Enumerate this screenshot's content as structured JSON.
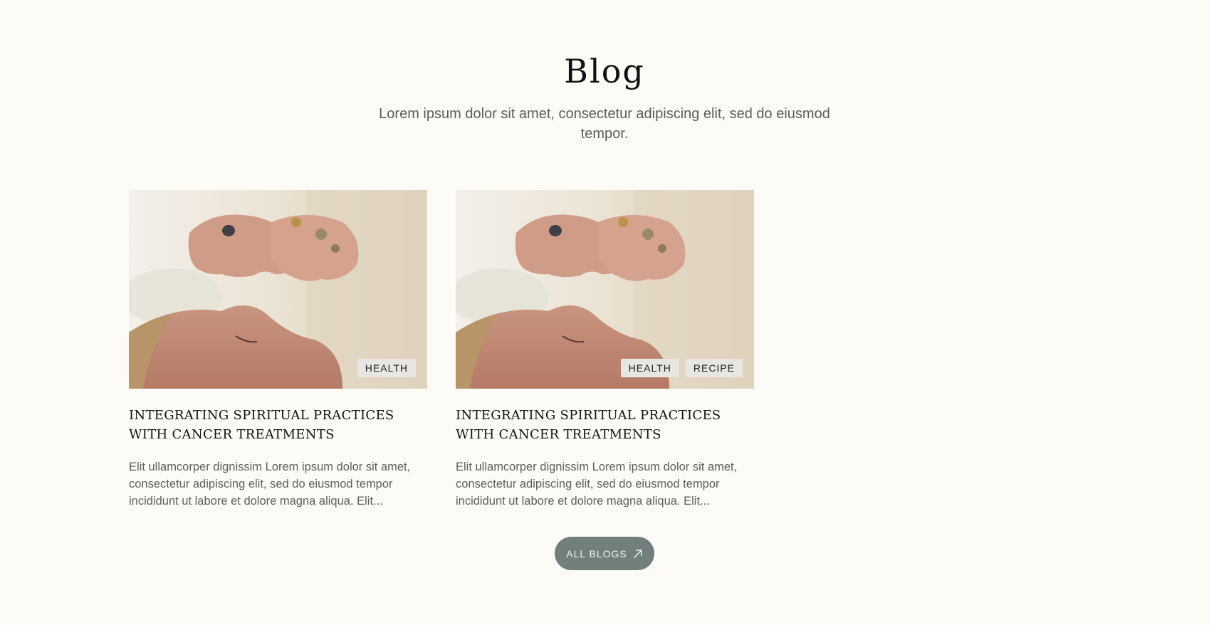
{
  "section": {
    "title": "Blog",
    "subtitle": "Lorem ipsum dolor sit amet, consectetur adipiscing elit, sed do eiusmod tempor."
  },
  "posts": [
    {
      "tags": [
        "HEALTH"
      ],
      "title": "INTEGRATING SPIRITUAL PRACTICES WITH CANCER TREATMENTS",
      "excerpt": "Elit ullamcorper dignissim Lorem ipsum dolor sit amet, consectetur adipiscing elit, sed do eiusmod tempor incididunt ut labore et dolore magna aliqua. Elit..."
    },
    {
      "tags": [
        "HEALTH",
        "RECIPE"
      ],
      "title": "INTEGRATING SPIRITUAL PRACTICES WITH CANCER TREATMENTS",
      "excerpt": "Elit ullamcorper dignissim Lorem ipsum dolor sit amet, consectetur adipiscing elit, sed do eiusmod tempor incididunt ut labore et dolore magna aliqua. Elit..."
    }
  ],
  "cta": {
    "label": "ALL BLOGS",
    "icon": "arrow-up-right-icon"
  },
  "colors": {
    "background": "#fcfbf6",
    "button": "#717f7d",
    "tag_background": "#e7e6e3"
  }
}
